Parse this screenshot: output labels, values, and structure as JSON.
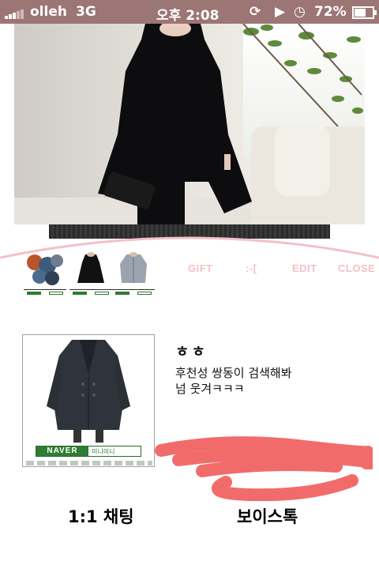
{
  "status_bar": {
    "carrier": "olleh",
    "network": "3G",
    "time": "오후 2:08",
    "battery_percent": "72%",
    "battery_level": 0.72,
    "icons": [
      "signal-icon",
      "orientation-lock-icon",
      "play-icon",
      "alarm-icon",
      "battery-icon"
    ]
  },
  "menu": {
    "gift": "GIFT",
    "emoticon": ":-[",
    "edit": "EDIT",
    "close": "CLOSE"
  },
  "chat": {
    "name": "ㅎㅎ",
    "message_line1": "후천성 쌍동이 검색해봐",
    "message_line2": "넘 웃겨ㅋㅋㅋ"
  },
  "product": {
    "naver_label": "NAVER",
    "naver_sub": "미니미니"
  },
  "buttons": {
    "chat": "1:1 채팅",
    "voice": "보이스톡"
  },
  "colors": {
    "status_bar": "#9c7575",
    "menu_text": "#f3c1c8",
    "scribble": "#f26b6b",
    "arc": "#f3c1c8"
  }
}
